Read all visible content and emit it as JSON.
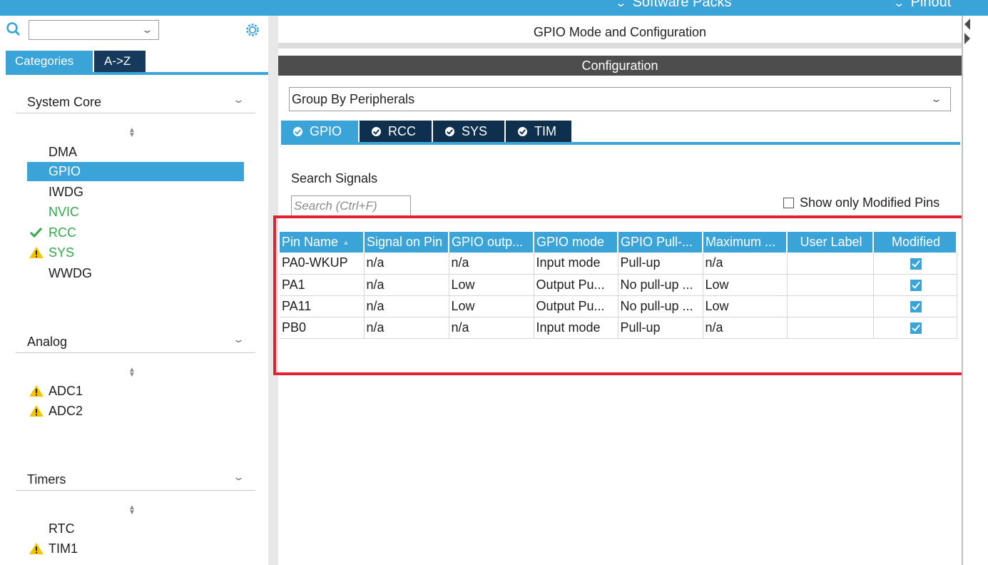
{
  "topbar": {
    "software_packs": "Software Packs",
    "pinout": "Pinout"
  },
  "left": {
    "search_placeholder": "",
    "tabs": {
      "categories": "Categories",
      "az": "A->Z"
    },
    "sections": [
      {
        "title": "System Core",
        "items": [
          {
            "label": "DMA",
            "state": "normal"
          },
          {
            "label": "GPIO",
            "state": "selected"
          },
          {
            "label": "IWDG",
            "state": "normal"
          },
          {
            "label": "NVIC",
            "state": "green"
          },
          {
            "label": "RCC",
            "state": "ok"
          },
          {
            "label": "SYS",
            "state": "warning"
          },
          {
            "label": "WWDG",
            "state": "normal"
          }
        ]
      },
      {
        "title": "Analog",
        "items": [
          {
            "label": "ADC1",
            "state": "warning"
          },
          {
            "label": "ADC2",
            "state": "warning"
          }
        ]
      },
      {
        "title": "Timers",
        "items": [
          {
            "label": "RTC",
            "state": "normal"
          },
          {
            "label": "TIM1",
            "state": "warning"
          }
        ]
      }
    ]
  },
  "right": {
    "title": "GPIO Mode and Configuration",
    "config_bar": "Configuration",
    "group_by": "Group By Peripherals",
    "tabs": [
      "GPIO",
      "RCC",
      "SYS",
      "TIM"
    ],
    "search_label": "Search Signals",
    "search_placeholder": "Search (Ctrl+F)",
    "show_modified_label": "Show only Modified Pins",
    "table": {
      "headers": [
        "Pin Name",
        "Signal on Pin",
        "GPIO outp...",
        "GPIO mode",
        "GPIO Pull-...",
        "Maximum ...",
        "User Label",
        "Modified"
      ],
      "rows": [
        [
          "PA0-WKUP",
          "n/a",
          "n/a",
          "Input mode",
          "Pull-up",
          "n/a",
          "",
          true
        ],
        [
          "PA1",
          "n/a",
          "Low",
          "Output Pu...",
          "No pull-up ...",
          "Low",
          "",
          true
        ],
        [
          "PA11",
          "n/a",
          "Low",
          "Output Pu...",
          "No pull-up ...",
          "Low",
          "",
          true
        ],
        [
          "PB0",
          "n/a",
          "n/a",
          "Input mode",
          "Pull-up",
          "n/a",
          "",
          true
        ]
      ]
    }
  },
  "colors": {
    "accent": "#3aa3d8",
    "dark_tab": "#0f2f4e",
    "config_bar": "#4d4d4d",
    "warning": "#f5c400",
    "ok_green": "#31a84a",
    "highlight_red": "#e0232e"
  },
  "icons": {
    "search": "search-icon",
    "gear": "gear-icon",
    "check": "checkmark-icon",
    "warning": "warning-icon",
    "chevron": "chevron-down-icon"
  }
}
